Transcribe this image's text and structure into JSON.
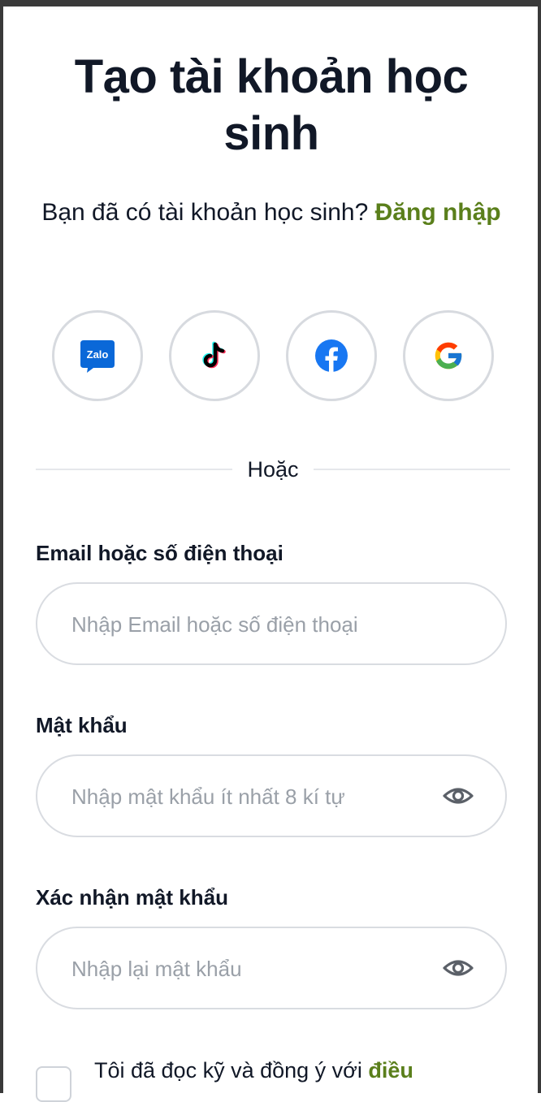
{
  "header": {
    "title": "Tạo tài khoản học sinh"
  },
  "login_prompt": {
    "text": "Bạn đã có tài khoản học sinh? ",
    "link": "Đăng nhập"
  },
  "social_logins": [
    {
      "name": "Zalo",
      "icon": "zalo-icon",
      "logo_text": "Zalo",
      "color": "#0068ff"
    },
    {
      "name": "TikTok",
      "icon": "tiktok-icon"
    },
    {
      "name": "Facebook",
      "icon": "facebook-icon",
      "color": "#1877f2"
    },
    {
      "name": "Google",
      "icon": "google-icon"
    }
  ],
  "divider": {
    "text": "Hoặc"
  },
  "form": {
    "email": {
      "label": "Email hoặc số điện thoại",
      "placeholder": "Nhập Email hoặc số điện thoại",
      "value": ""
    },
    "password": {
      "label": "Mật khẩu",
      "placeholder": "Nhập mật khẩu ít nhất 8 kí tự",
      "value": ""
    },
    "confirm_password": {
      "label": "Xác nhận mật khẩu",
      "placeholder": "Nhập lại mật khẩu",
      "value": ""
    }
  },
  "terms": {
    "text": "Tôi đã đọc kỹ và đồng ý với ",
    "link": "điều"
  },
  "colors": {
    "accent": "#5a7f1b",
    "border": "#d9dce1",
    "placeholder": "#9aa0a8"
  }
}
